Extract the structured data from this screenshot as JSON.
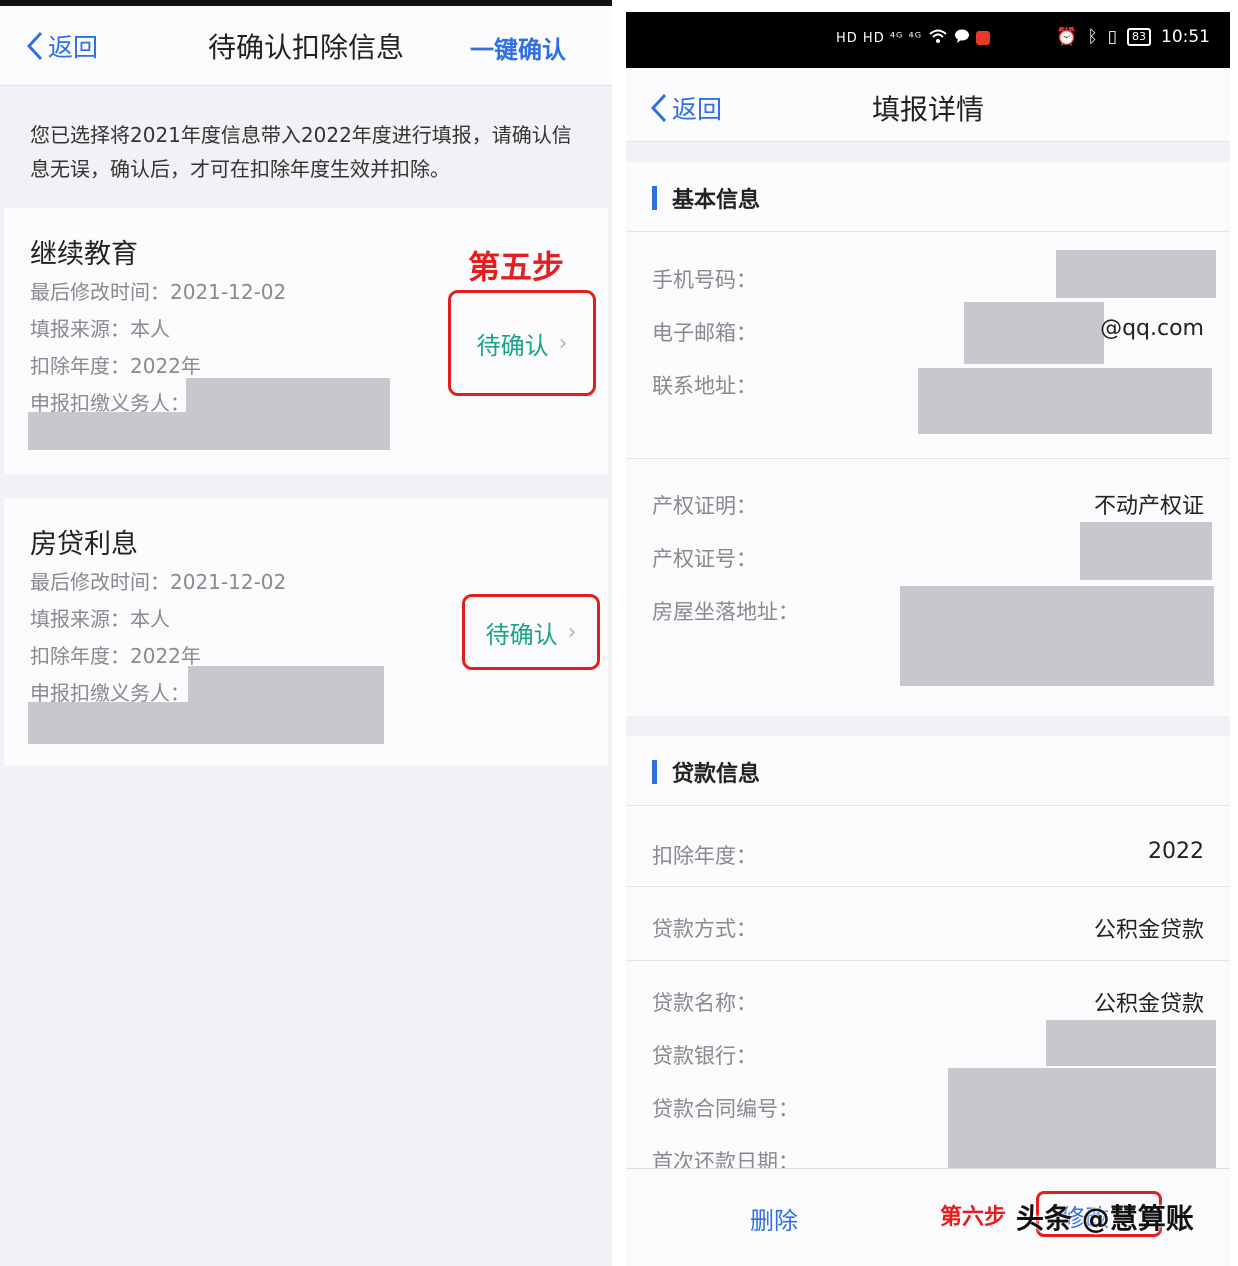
{
  "left": {
    "nav": {
      "back_label": "返回",
      "title": "待确认扣除信息",
      "confirm_all": "一键确认"
    },
    "notice": "您已选择将2021年度信息带入2022年度进行填报，请确认信息无误，确认后，才可在扣除年度生效并扣除。",
    "step_label": "第五步",
    "cards": [
      {
        "title": "继续教育",
        "modified": "最后修改时间：2021-12-02",
        "source": "填报来源：本人",
        "year": "扣除年度：2022年",
        "withholder": "申报扣缴义务人：",
        "button": "待确认"
      },
      {
        "title": "房贷利息",
        "modified": "最后修改时间：2021-12-02",
        "source": "填报来源：本人",
        "year": "扣除年度：2022年",
        "withholder": "申报扣缴义务人：",
        "button": "待确认"
      }
    ]
  },
  "right": {
    "statusbar": {
      "left_icons": "HD HD ⁴ᴳ ⁴ᴳ",
      "battery": "83",
      "time": "10:51"
    },
    "nav": {
      "back_label": "返回",
      "title": "填报详情"
    },
    "basic": {
      "header": "基本信息",
      "phone_label": "手机号码：",
      "email_label": "电子邮箱：",
      "email_value": "@qq.com",
      "address_label": "联系地址：",
      "cert_label": "产权证明：",
      "cert_value": "不动产权证",
      "cert_no_label": "产权证号：",
      "house_label": "房屋坐落地址："
    },
    "loan": {
      "header": "贷款信息",
      "year_label": "扣除年度：",
      "year_value": "2022",
      "method_label": "贷款方式：",
      "method_value": "公积金贷款",
      "name_label": "贷款名称：",
      "name_value": "公积金贷款",
      "bank_label": "贷款银行：",
      "contract_label": "贷款合同编号：",
      "first_pay_label": "首次还款日期："
    },
    "bottom": {
      "delete": "删除",
      "step_label": "第六步",
      "modify": "修改",
      "watermark": "头条 @慧算账"
    }
  }
}
